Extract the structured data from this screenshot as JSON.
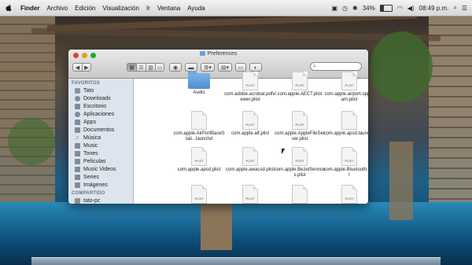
{
  "menubar": {
    "app_name": "Finder",
    "items": [
      "Archivo",
      "Edición",
      "Visualización",
      "Ir",
      "Ventana",
      "Ayuda"
    ],
    "battery_percent": "34%",
    "battery_level": 0.34,
    "clock": "08:49 p.m."
  },
  "window": {
    "title": "Preferences",
    "search_placeholder": ""
  },
  "sidebar": {
    "favorites_header": "FAVORITOS",
    "favorites": [
      "Tato",
      "Downloads",
      "Escritorio",
      "Aplicaciones",
      "Apps",
      "Documentos",
      "Música",
      "Music",
      "Tones",
      "Películas",
      "Music Videos",
      "Series",
      "Imágenes"
    ],
    "shared_header": "COMPARTIDO",
    "shared": [
      "tato-pc"
    ]
  },
  "files": [
    {
      "name": "Audio",
      "kind": "folder"
    },
    {
      "name": "com.adobe.acrobat.pdfviewer.plist",
      "kind": "plist"
    },
    {
      "name": "com.apple.AECT.plist",
      "kind": "plist"
    },
    {
      "name": "com.apple.airport.opproam.plist",
      "kind": "plist"
    },
    {
      "name": "com.apple.AirPortBaseStati...launchd",
      "kind": "file"
    },
    {
      "name": "com.apple.alf.plist",
      "kind": "plist"
    },
    {
      "name": "com.apple.AppleFileServer.plist",
      "kind": "plist"
    },
    {
      "name": "com.apple.apsd.launchd",
      "kind": "file"
    },
    {
      "name": "com.apple.apsd.plist",
      "kind": "plist"
    },
    {
      "name": "com.apple.awacsd.plist",
      "kind": "plist"
    },
    {
      "name": "com.apple.BezelServices.plist",
      "kind": "plist"
    },
    {
      "name": "com.apple.Bluetooth.plist",
      "kind": "plist"
    },
    {
      "name": "",
      "kind": "plist"
    },
    {
      "name": "",
      "kind": "plist"
    },
    {
      "name": "",
      "kind": "file"
    },
    {
      "name": "",
      "kind": "plist"
    }
  ],
  "doc_tag": "PLIST"
}
